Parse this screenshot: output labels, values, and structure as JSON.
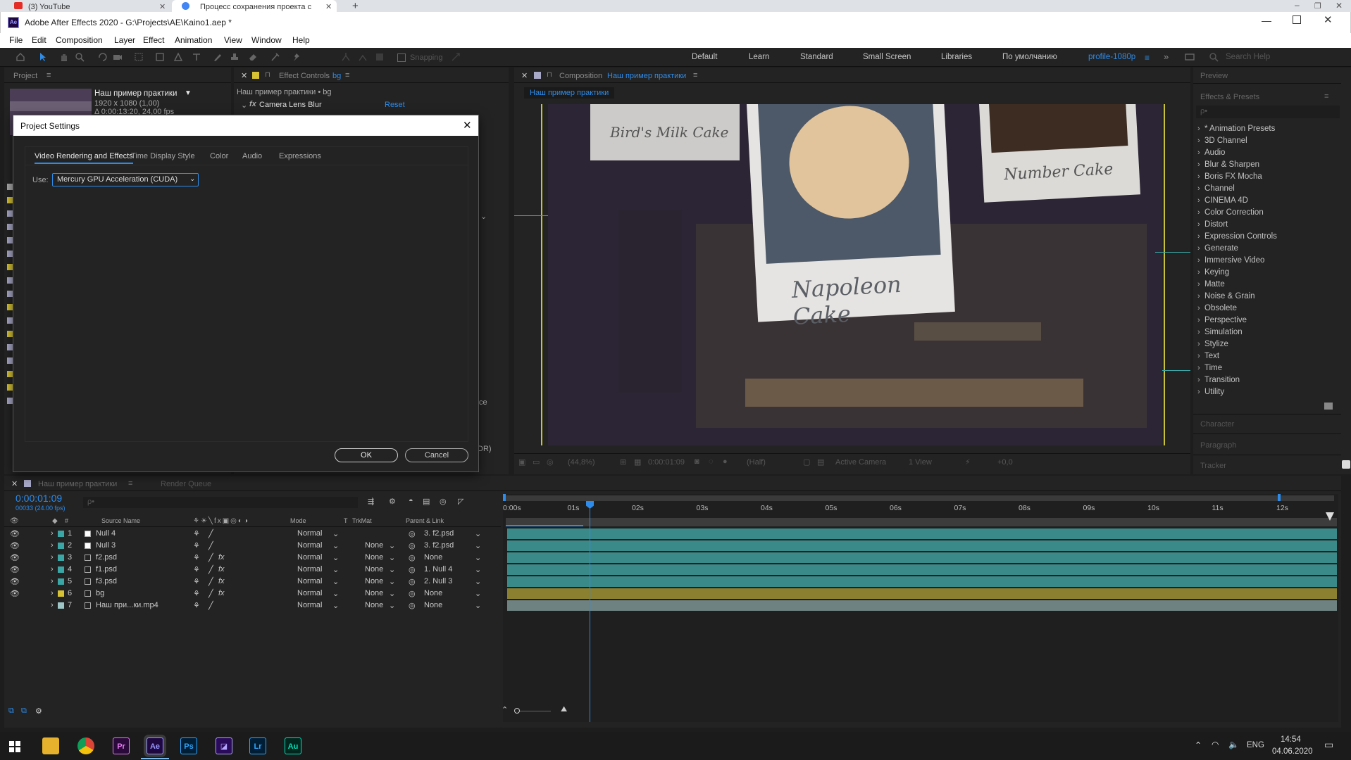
{
  "browser": {
    "tabs": [
      {
        "label": "(3) YouTube"
      },
      {
        "label": "Процесс сохранения проекта с"
      }
    ]
  },
  "app": {
    "title": "Adobe After Effects 2020 - G:\\Projects\\AE\\Kaino1.aep *",
    "menu": [
      "File",
      "Edit",
      "Composition",
      "Layer",
      "Effect",
      "Animation",
      "View",
      "Window",
      "Help"
    ]
  },
  "toolbar": {
    "snapping": "Snapping",
    "workspaces": [
      "Default",
      "Learn",
      "Standard",
      "Small Screen",
      "Libraries",
      "По умолчанию"
    ],
    "active_workspace": "profile-1080p",
    "search_placeholder": "Search Help"
  },
  "project_panel": {
    "tab": "Project",
    "comp_name": "Наш пример практики",
    "comp_size": "1920 x 1080 (1,00)",
    "comp_duration": "Δ 0:00:13:20, 24,00 fps"
  },
  "effect_controls": {
    "tab_prefix": "Effect Controls",
    "tab_layer": "bg",
    "path": "Наш пример практики • bg",
    "effect_name": "Camera Lens Blur",
    "reset": "Reset",
    "partial_1": "ce",
    "partial_2": "DR)"
  },
  "dialog": {
    "title": "Project Settings",
    "tabs": [
      "Video Rendering and Effects",
      "Time Display Style",
      "Color",
      "Audio",
      "Expressions"
    ],
    "use_label": "Use:",
    "use_value": "Mercury GPU Acceleration (CUDA)",
    "ok": "OK",
    "cancel": "Cancel"
  },
  "composition": {
    "tab_prefix": "Composition",
    "tab_name": "Наш пример практики",
    "breadcrumb": "Наш пример практики",
    "card_left": "Bird's Milk Cake",
    "card_center": "Napoleon Cake",
    "card_right": "Number Cake",
    "zoom": "(44,8%)",
    "timecode": "0:00:01:09",
    "resolution": "(Half)",
    "camera": "Active Camera",
    "views": "1 View",
    "exposure": "+0,0"
  },
  "right_panel": {
    "preview": "Preview",
    "effects_presets": "Effects & Presets",
    "search_placeholder": "ρ•",
    "categories": [
      "* Animation Presets",
      "3D Channel",
      "Audio",
      "Blur & Sharpen",
      "Boris FX Mocha",
      "Channel",
      "CINEMA 4D",
      "Color Correction",
      "Distort",
      "Expression Controls",
      "Generate",
      "Immersive Video",
      "Keying",
      "Matte",
      "Noise & Grain",
      "Obsolete",
      "Perspective",
      "Simulation",
      "Stylize",
      "Text",
      "Time",
      "Transition",
      "Utility"
    ],
    "character": "Character",
    "paragraph": "Paragraph",
    "tracker": "Tracker"
  },
  "timeline": {
    "tab": "Наш пример практики",
    "render_queue": "Render Queue",
    "timecode": "0:00:01:09",
    "frames": "00033 (24.00 fps)",
    "search_placeholder": "ρ•",
    "columns": {
      "num": "#",
      "source": "Source Name",
      "mode": "Mode",
      "t": "T",
      "trkmat": "TrkMat",
      "parent": "Parent & Link"
    },
    "layers": [
      {
        "num": "1",
        "name": "Null 4",
        "color": "#3aa6a6",
        "fx": "",
        "mode": "Normal",
        "trkmat": "",
        "parent": "3. f2.psd"
      },
      {
        "num": "2",
        "name": "Null 3",
        "color": "#3aa6a6",
        "fx": "",
        "mode": "Normal",
        "trkmat": "None",
        "parent": "3. f2.psd"
      },
      {
        "num": "3",
        "name": "f2.psd",
        "color": "#3aa6a6",
        "fx": "fx",
        "mode": "Normal",
        "trkmat": "None",
        "parent": "None"
      },
      {
        "num": "4",
        "name": "f1.psd",
        "color": "#3aa6a6",
        "fx": "fx",
        "mode": "Normal",
        "trkmat": "None",
        "parent": "1. Null 4"
      },
      {
        "num": "5",
        "name": "f3.psd",
        "color": "#3aa6a6",
        "fx": "fx",
        "mode": "Normal",
        "trkmat": "None",
        "parent": "2. Null 3"
      },
      {
        "num": "6",
        "name": "bg",
        "color": "#d6c233",
        "fx": "fx",
        "mode": "Normal",
        "trkmat": "None",
        "parent": "None"
      },
      {
        "num": "7",
        "name": "Наш при...ки.mp4",
        "color": "#9ec6c6",
        "fx": "",
        "mode": "Normal",
        "trkmat": "None",
        "parent": "None"
      }
    ],
    "ruler": [
      "0:00s",
      "01s",
      "02s",
      "03s",
      "04s",
      "05s",
      "06s",
      "07s",
      "08s",
      "09s",
      "10s",
      "11s",
      "12s"
    ],
    "bar_colors": [
      "#3b8a8a",
      "#3b8a8a",
      "#3b8a8a",
      "#3b8a8a",
      "#3b8a8a",
      "#8b8030",
      "#6e8282"
    ]
  },
  "taskbar": {
    "apps": [
      "Pr",
      "Ae",
      "Ps",
      "Lr",
      "Au"
    ],
    "lang": "ENG",
    "time": "14:54",
    "date": "04.06.2020"
  }
}
